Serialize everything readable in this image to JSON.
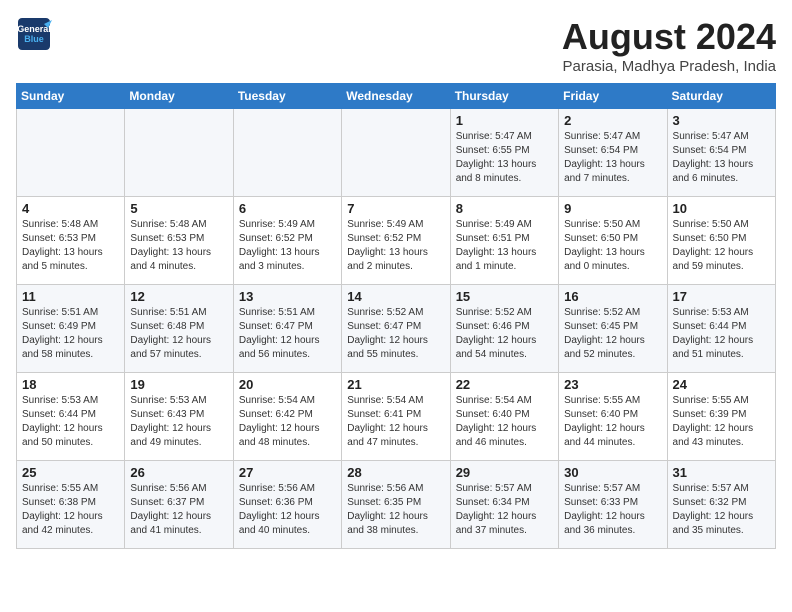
{
  "header": {
    "logo_line1": "General",
    "logo_line2": "Blue",
    "month_year": "August 2024",
    "location": "Parasia, Madhya Pradesh, India"
  },
  "days_of_week": [
    "Sunday",
    "Monday",
    "Tuesday",
    "Wednesday",
    "Thursday",
    "Friday",
    "Saturday"
  ],
  "weeks": [
    [
      {
        "day": "",
        "info": ""
      },
      {
        "day": "",
        "info": ""
      },
      {
        "day": "",
        "info": ""
      },
      {
        "day": "",
        "info": ""
      },
      {
        "day": "1",
        "info": "Sunrise: 5:47 AM\nSunset: 6:55 PM\nDaylight: 13 hours\nand 8 minutes."
      },
      {
        "day": "2",
        "info": "Sunrise: 5:47 AM\nSunset: 6:54 PM\nDaylight: 13 hours\nand 7 minutes."
      },
      {
        "day": "3",
        "info": "Sunrise: 5:47 AM\nSunset: 6:54 PM\nDaylight: 13 hours\nand 6 minutes."
      }
    ],
    [
      {
        "day": "4",
        "info": "Sunrise: 5:48 AM\nSunset: 6:53 PM\nDaylight: 13 hours\nand 5 minutes."
      },
      {
        "day": "5",
        "info": "Sunrise: 5:48 AM\nSunset: 6:53 PM\nDaylight: 13 hours\nand 4 minutes."
      },
      {
        "day": "6",
        "info": "Sunrise: 5:49 AM\nSunset: 6:52 PM\nDaylight: 13 hours\nand 3 minutes."
      },
      {
        "day": "7",
        "info": "Sunrise: 5:49 AM\nSunset: 6:52 PM\nDaylight: 13 hours\nand 2 minutes."
      },
      {
        "day": "8",
        "info": "Sunrise: 5:49 AM\nSunset: 6:51 PM\nDaylight: 13 hours\nand 1 minute."
      },
      {
        "day": "9",
        "info": "Sunrise: 5:50 AM\nSunset: 6:50 PM\nDaylight: 13 hours\nand 0 minutes."
      },
      {
        "day": "10",
        "info": "Sunrise: 5:50 AM\nSunset: 6:50 PM\nDaylight: 12 hours\nand 59 minutes."
      }
    ],
    [
      {
        "day": "11",
        "info": "Sunrise: 5:51 AM\nSunset: 6:49 PM\nDaylight: 12 hours\nand 58 minutes."
      },
      {
        "day": "12",
        "info": "Sunrise: 5:51 AM\nSunset: 6:48 PM\nDaylight: 12 hours\nand 57 minutes."
      },
      {
        "day": "13",
        "info": "Sunrise: 5:51 AM\nSunset: 6:47 PM\nDaylight: 12 hours\nand 56 minutes."
      },
      {
        "day": "14",
        "info": "Sunrise: 5:52 AM\nSunset: 6:47 PM\nDaylight: 12 hours\nand 55 minutes."
      },
      {
        "day": "15",
        "info": "Sunrise: 5:52 AM\nSunset: 6:46 PM\nDaylight: 12 hours\nand 54 minutes."
      },
      {
        "day": "16",
        "info": "Sunrise: 5:52 AM\nSunset: 6:45 PM\nDaylight: 12 hours\nand 52 minutes."
      },
      {
        "day": "17",
        "info": "Sunrise: 5:53 AM\nSunset: 6:44 PM\nDaylight: 12 hours\nand 51 minutes."
      }
    ],
    [
      {
        "day": "18",
        "info": "Sunrise: 5:53 AM\nSunset: 6:44 PM\nDaylight: 12 hours\nand 50 minutes."
      },
      {
        "day": "19",
        "info": "Sunrise: 5:53 AM\nSunset: 6:43 PM\nDaylight: 12 hours\nand 49 minutes."
      },
      {
        "day": "20",
        "info": "Sunrise: 5:54 AM\nSunset: 6:42 PM\nDaylight: 12 hours\nand 48 minutes."
      },
      {
        "day": "21",
        "info": "Sunrise: 5:54 AM\nSunset: 6:41 PM\nDaylight: 12 hours\nand 47 minutes."
      },
      {
        "day": "22",
        "info": "Sunrise: 5:54 AM\nSunset: 6:40 PM\nDaylight: 12 hours\nand 46 minutes."
      },
      {
        "day": "23",
        "info": "Sunrise: 5:55 AM\nSunset: 6:40 PM\nDaylight: 12 hours\nand 44 minutes."
      },
      {
        "day": "24",
        "info": "Sunrise: 5:55 AM\nSunset: 6:39 PM\nDaylight: 12 hours\nand 43 minutes."
      }
    ],
    [
      {
        "day": "25",
        "info": "Sunrise: 5:55 AM\nSunset: 6:38 PM\nDaylight: 12 hours\nand 42 minutes."
      },
      {
        "day": "26",
        "info": "Sunrise: 5:56 AM\nSunset: 6:37 PM\nDaylight: 12 hours\nand 41 minutes."
      },
      {
        "day": "27",
        "info": "Sunrise: 5:56 AM\nSunset: 6:36 PM\nDaylight: 12 hours\nand 40 minutes."
      },
      {
        "day": "28",
        "info": "Sunrise: 5:56 AM\nSunset: 6:35 PM\nDaylight: 12 hours\nand 38 minutes."
      },
      {
        "day": "29",
        "info": "Sunrise: 5:57 AM\nSunset: 6:34 PM\nDaylight: 12 hours\nand 37 minutes."
      },
      {
        "day": "30",
        "info": "Sunrise: 5:57 AM\nSunset: 6:33 PM\nDaylight: 12 hours\nand 36 minutes."
      },
      {
        "day": "31",
        "info": "Sunrise: 5:57 AM\nSunset: 6:32 PM\nDaylight: 12 hours\nand 35 minutes."
      }
    ]
  ]
}
